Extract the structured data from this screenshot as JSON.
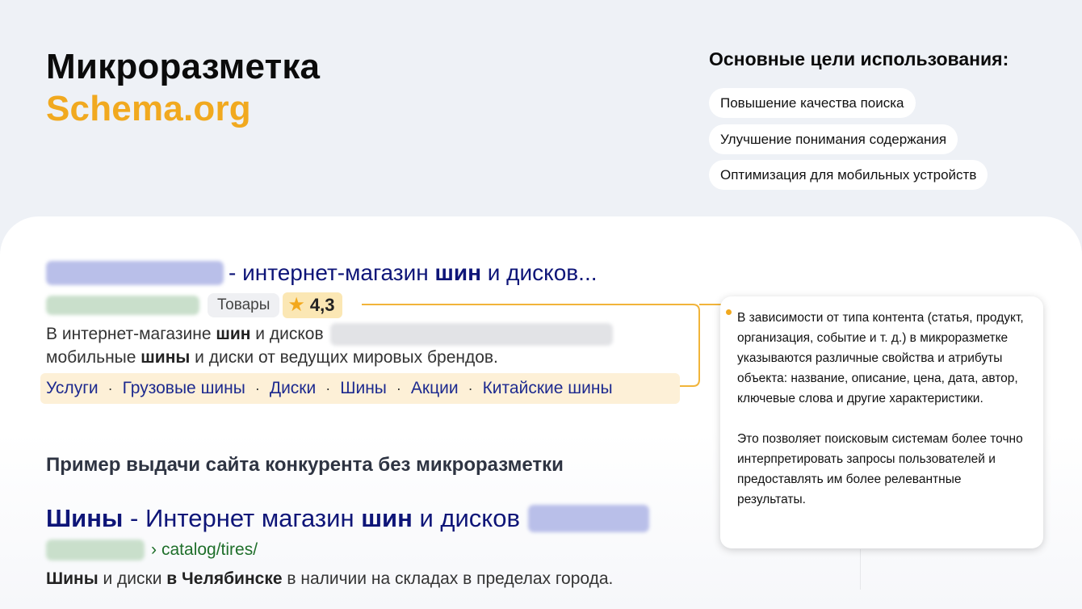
{
  "header": {
    "title": "Микроразметка",
    "subtitle": "Schema.org",
    "goals_title": "Основные цели использования:",
    "goals": [
      "Повышение качества поиска",
      "Улучшение понимания содержания",
      "Оптимизация для мобильных устройств"
    ]
  },
  "serp_with_markup": {
    "title_sep": "- интернет-магазин",
    "title_bold": "шин",
    "title_end": "и дисков...",
    "tag": "Товары",
    "rating": "4,3",
    "snippet_line1_a": "В интернет-магазине",
    "snippet_line1_b": "шин",
    "snippet_line1_c": "и дисков",
    "snippet_line2_a": "мобильные",
    "snippet_line2_b": "шины",
    "snippet_line2_c": "и диски от ведущих мировых брендов.",
    "sitelinks": [
      "Услуги",
      "Грузовые шины",
      "Диски",
      "Шины",
      "Акции",
      "Китайские шины"
    ],
    "separator": "·"
  },
  "competitor": {
    "heading": "Пример выдачи сайта конкурента без микроразметки",
    "title_bold1": "Шины",
    "title_mid": "- Интернет магазин",
    "title_bold2": "шин",
    "title_end": "и дисков",
    "url_chevron": "›",
    "url_path": "catalog/tires/",
    "snippet_bold1": "Шины",
    "snippet_mid": "и диски",
    "snippet_bold2": "в Челябинске",
    "snippet_end": "в наличии на складах в пределах города."
  },
  "callout": {
    "paragraph1": "В зависимости от типа контента (статья, продукт, организация, событие и т. д.) в микроразметке указываются различные свойства и атрибуты объекта: название, описание, цена, дата, автор, ключевые слова и другие характеристики.",
    "paragraph2": "Это позволяет поисковым системам более точно интерпретировать запросы пользователей и предоставлять им более релевантные результаты."
  },
  "colors": {
    "accent": "#f1a91f",
    "link": "#0e1578",
    "url_green": "#1f6f2b",
    "highlight": "#fdf0d7"
  },
  "icons": {
    "rating": "star-icon"
  }
}
